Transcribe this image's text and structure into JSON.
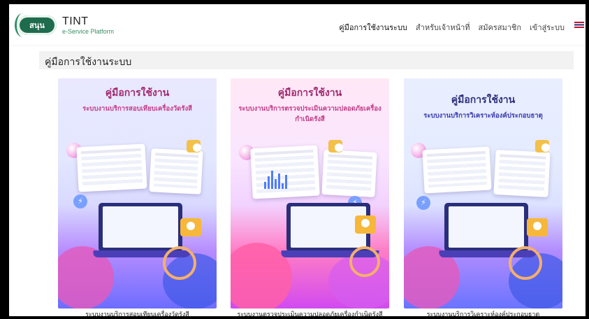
{
  "brand": {
    "badge": "สนุน",
    "title": "TINT",
    "subtitle": "e-Service Platform"
  },
  "nav": {
    "items": [
      "คู่มือการใช้งานระบบ",
      "สำหรับเจ้าหน้าที่",
      "สมัครสมาชิก",
      "เข้าสู่ระบบ"
    ]
  },
  "page": {
    "title": "คู่มือการใช้งานระบบ"
  },
  "cards": [
    {
      "heading": "คู่มือการใช้งาน",
      "subheading": "ระบบงานบริการสอบเทียบเครื่องวัดรังสี",
      "caption": "ระบบงานบริการสอบเทียบเครื่องวัดรังสี"
    },
    {
      "heading": "คู่มือการใช้งาน",
      "subheading": "ระบบงานบริการตรวจประเมินความปลอดภัยเครื่องกำเนิดรังสี",
      "caption": "ระบบงานตรวจประเมินความปลอดภัยเครื่องกำเนิดรังสี"
    },
    {
      "heading": "คู่มือการใช้งาน",
      "subheading": "ระบบงานบริการวิเคราะห์องค์ประกอบธาตุ",
      "caption": "ระบบงานบริการวิเคราะห์องค์ประกอบธาตุ"
    }
  ],
  "colors": {
    "brand_green": "#1f6b4e",
    "title_pink": "#a0296f",
    "title_navy": "#2d2f7a"
  }
}
